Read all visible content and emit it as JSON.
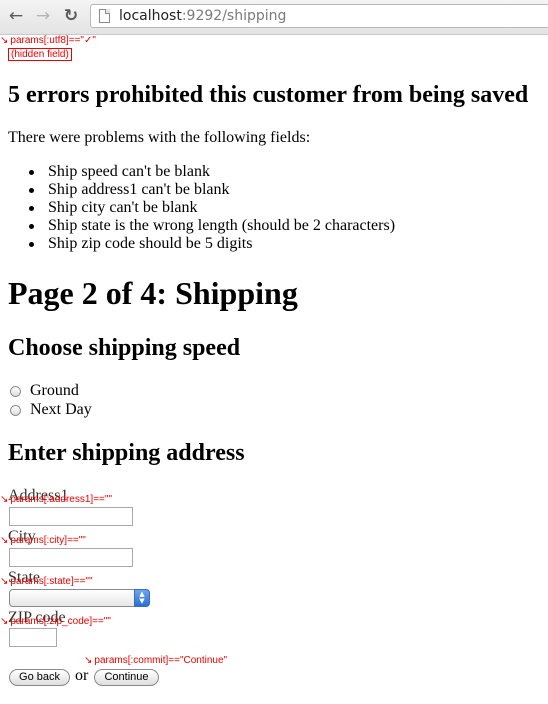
{
  "browser": {
    "url_host": "localhost",
    "url_path": ":9292/shipping",
    "back_icon": "back-arrow-icon",
    "forward_icon": "forward-arrow-icon",
    "reload_icon": "reload-icon"
  },
  "debug": {
    "utf8": "params[:utf8]==\"✓\"",
    "hidden_field": "(hidden field)",
    "address1": "params[:address1]==\"\"",
    "city": "params[:city]==\"\"",
    "state": "params[:state]==\"\"",
    "zip_code": "params[:zip_code]==\"\"",
    "commit": "params[:commit]==\"Continue\"",
    "arrow": "↘"
  },
  "errors": {
    "title": "5 errors prohibited this customer from being saved",
    "intro": "There were problems with the following fields:",
    "items": [
      "Ship speed can't be blank",
      "Ship address1 can't be blank",
      "Ship city can't be blank",
      "Ship state is the wrong length (should be 2 characters)",
      "Ship zip code should be 5 digits"
    ]
  },
  "page": {
    "title": "Page 2 of 4: Shipping"
  },
  "speed": {
    "heading": "Choose shipping speed",
    "options": [
      "Ground",
      "Next Day"
    ]
  },
  "address": {
    "heading": "Enter shipping address",
    "labels": {
      "address1": "Address1",
      "city": "City",
      "state": "State",
      "zip_code": "ZIP code"
    },
    "values": {
      "address1": "",
      "city": "",
      "state": "",
      "zip_code": ""
    }
  },
  "actions": {
    "back_label": "Go back",
    "or": "or",
    "continue_label": "Continue"
  }
}
